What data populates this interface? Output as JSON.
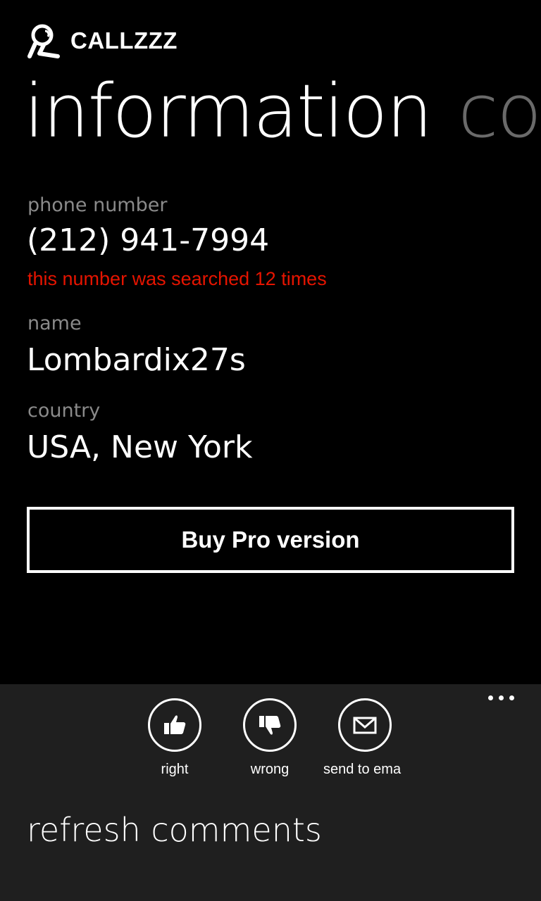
{
  "app": {
    "title": "CALLZZZ",
    "logo_icon": "headset-logo-icon"
  },
  "pivot": {
    "active": "information",
    "next": "co"
  },
  "info": {
    "phone_label": "phone number",
    "phone_value": "(212) 941-7994",
    "search_count": "this number was searched 12 times",
    "name_label": "name",
    "name_value": "Lombardix27s",
    "country_label": "country",
    "country_value": "USA, New York"
  },
  "buy_button": "Buy Pro version",
  "appbar": {
    "buttons": [
      {
        "label": "right",
        "icon": "thumbs-up-icon"
      },
      {
        "label": "wrong",
        "icon": "thumbs-down-icon"
      },
      {
        "label": "send to ema",
        "icon": "envelope-icon"
      }
    ],
    "menu_items": [
      "refresh comments"
    ]
  },
  "colors": {
    "background": "#000000",
    "appbar": "#1f1f1f",
    "label": "#8a8a8a",
    "warning": "#e51400",
    "pivot_inactive": "#6a6a6a"
  }
}
